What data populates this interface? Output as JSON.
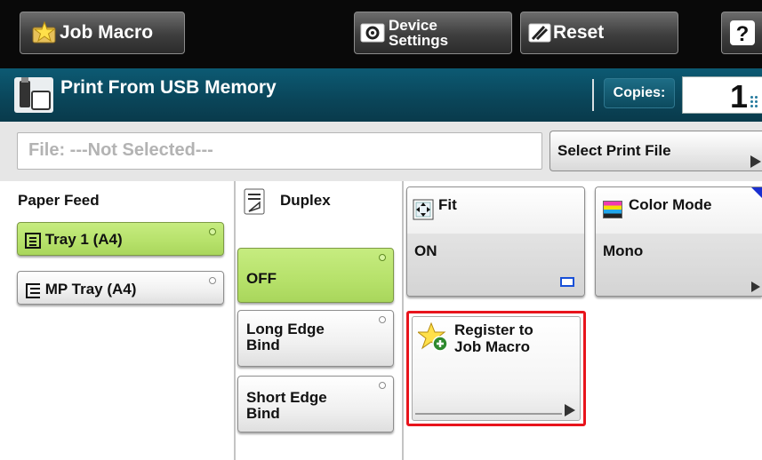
{
  "topbar": {
    "job_macro_label": "Job Macro",
    "device_settings_line1": "Device",
    "device_settings_line2": "Settings",
    "reset_label": "Reset",
    "help_label": "?"
  },
  "titlebar": {
    "title": "Print From USB Memory",
    "copies_label": "Copies:",
    "copies_value": "1"
  },
  "file": {
    "field_text": "File: ---Not Selected---",
    "select_button_label": "Select Print File"
  },
  "paper_feed": {
    "label": "Paper Feed",
    "options": [
      {
        "label": "Tray 1 (A4)",
        "selected": true
      },
      {
        "label": "MP Tray (A4)",
        "selected": false
      }
    ]
  },
  "duplex": {
    "label": "Duplex",
    "options": [
      {
        "label": "OFF",
        "selected": true
      },
      {
        "label_line1": "Long Edge",
        "label_line2": "Bind",
        "selected": false
      },
      {
        "label_line1": "Short Edge",
        "label_line2": "Bind",
        "selected": false
      }
    ]
  },
  "fit": {
    "label": "Fit",
    "value": "ON"
  },
  "color_mode": {
    "label": "Color Mode",
    "value": "Mono"
  },
  "register_macro": {
    "line1": "Register to",
    "line2": "Job Macro"
  },
  "colors": {
    "topbar_bg": "#090909",
    "titlebar_bg": "#0a4559",
    "selected_green": "#b6e16a",
    "highlight_red": "#e8141c"
  }
}
